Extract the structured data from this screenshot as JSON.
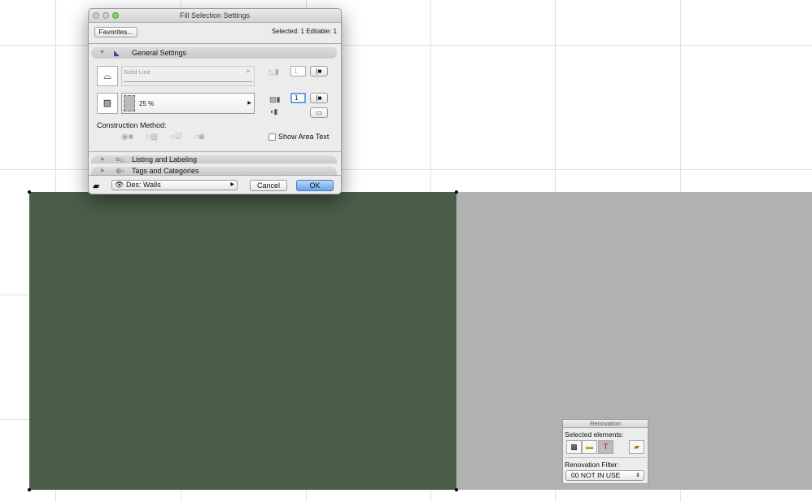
{
  "dialog": {
    "title": "Fill Selection Settings",
    "favorites_label": "Favorites...",
    "selection_status": "Selected: 1 Editable: 1",
    "general_settings": "General Settings",
    "line_type": "Solid Line",
    "fill_value": "25 %",
    "pen_1": "1",
    "pen_2": "1",
    "construction_method": "Construction Method:",
    "show_area_text": "Show Area Text",
    "listing_labeling": "Listing and Labeling",
    "tags_categories": "Tags and Categories",
    "layer": "Des: Walls",
    "cancel_label": "Cancel",
    "ok_label": "OK",
    "ok_color": "#7fb3ee"
  },
  "renovation": {
    "title": "Renovation",
    "selected_elements": "Selected elements:",
    "filter_label": "Renovation Filter:",
    "filter_value": "00 NOT IN USE"
  },
  "canvas": {
    "fill_color": "#4a5e4a",
    "background_fill_color": "#b1b1b1"
  }
}
